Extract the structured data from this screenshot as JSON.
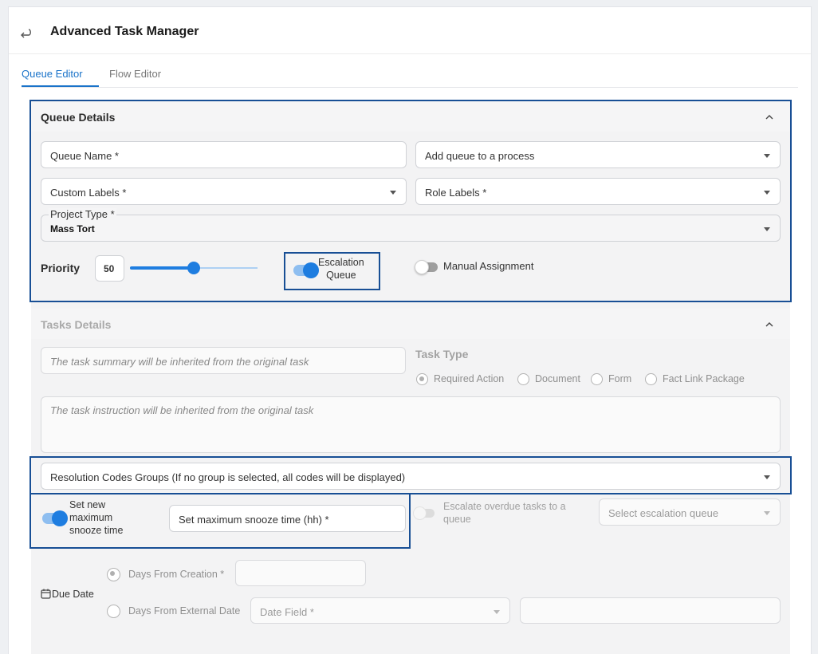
{
  "header": {
    "title": "Advanced Task Manager",
    "back_icon": "return-arrow-icon"
  },
  "tabs": [
    {
      "label": "Queue Editor",
      "active": true
    },
    {
      "label": "Flow Editor",
      "active": false
    }
  ],
  "queue_details": {
    "title": "Queue Details",
    "queue_name_placeholder": "Queue Name *",
    "process_placeholder": "Add queue to a process",
    "custom_labels_placeholder": "Custom Labels *",
    "role_labels_placeholder": "Role Labels *",
    "project_type_label": "Project Type *",
    "project_type_value": "Mass Tort",
    "priority_label": "Priority",
    "priority_value": "50",
    "priority_level": 0.5,
    "escalation_line1": "Escalation",
    "escalation_line2": "Queue",
    "manual_assignment": "Manual Assignment"
  },
  "tasks_details": {
    "title": "Tasks Details",
    "summary_placeholder": "The task summary will be inherited from the original task",
    "task_type_label": "Task Type",
    "task_types": [
      "Required Action",
      "Document",
      "Form",
      "Fact Link Package"
    ],
    "instruction_placeholder": "The task instruction will be inherited from the original task",
    "resolution_codes": "Resolution Codes Groups (If no group is selected, all codes will be displayed)",
    "snooze_line1": "Set new",
    "snooze_line2": "maximum",
    "snooze_line3": "snooze time",
    "snooze_field": "Set maximum snooze time (hh) *",
    "escalate_line1": "Escalate overdue tasks to a",
    "escalate_line2": "queue",
    "escalation_queue_placeholder": "Select escalation queue",
    "due_date_label": "Due Date",
    "days_from_creation": "Days From Creation *",
    "days_from_external": "Days From External Date",
    "date_field_placeholder": "Date Field *"
  },
  "colors": {
    "accent": "#1e7de0",
    "highlight": "#184f95"
  }
}
